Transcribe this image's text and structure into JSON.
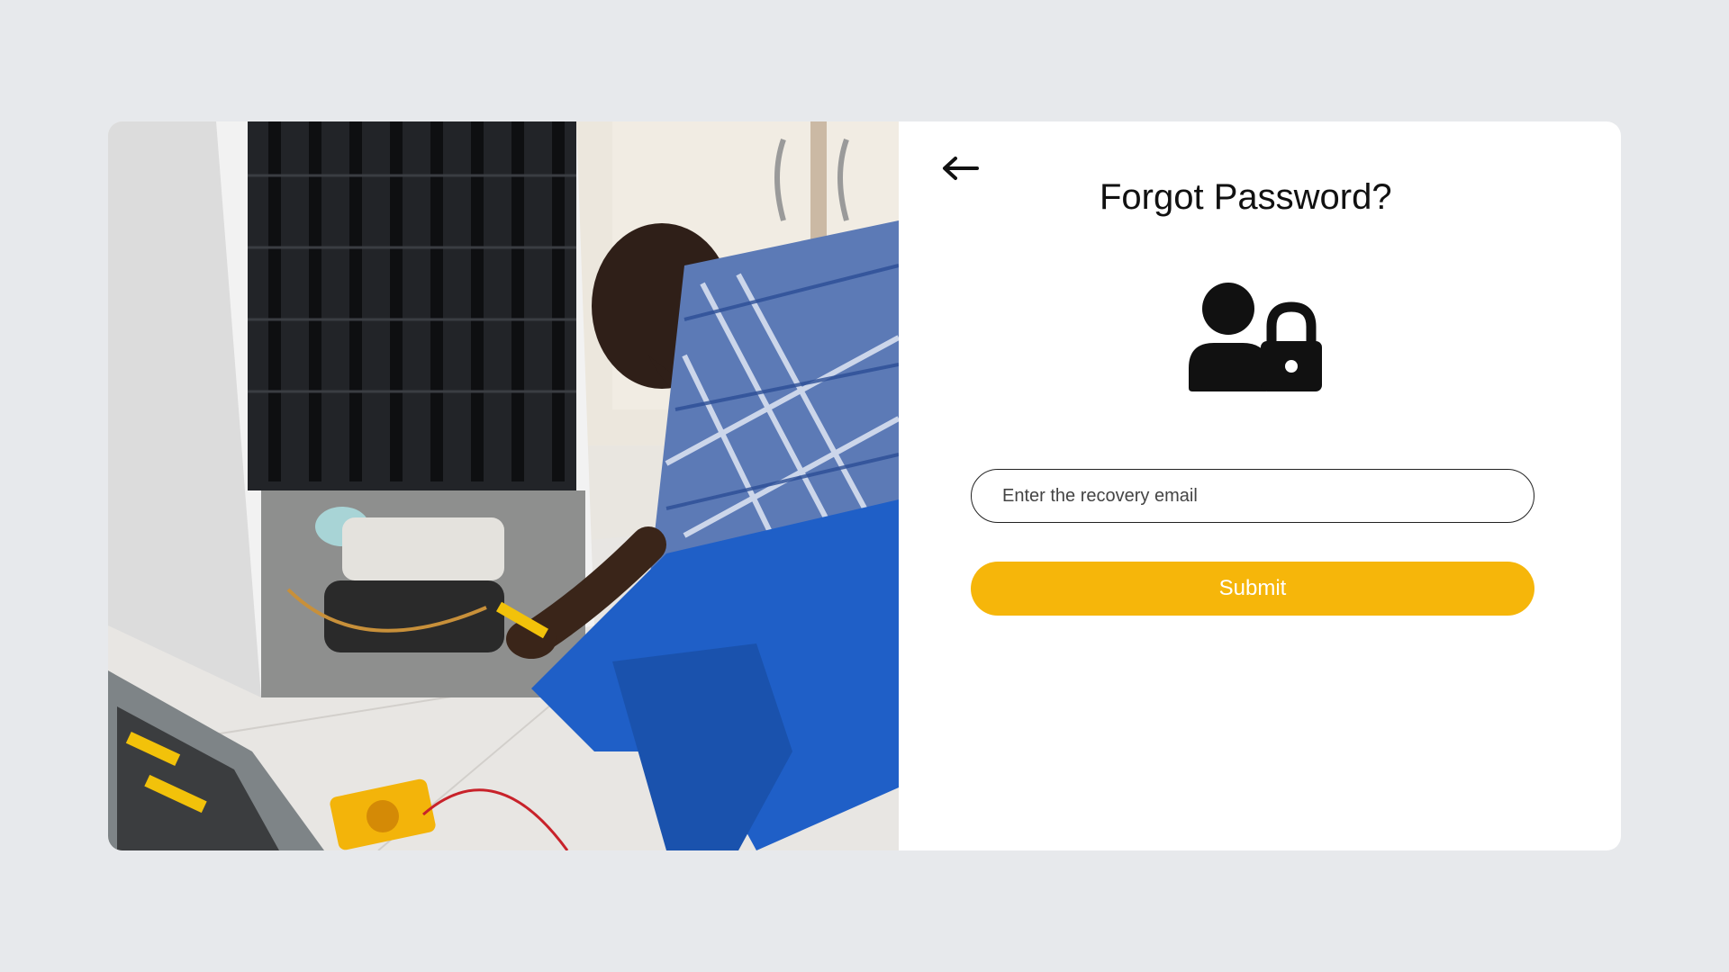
{
  "page": {
    "title": "Forgot Password?",
    "back_icon": "arrow-left-icon",
    "illustration_icon": "user-lock-icon"
  },
  "form": {
    "email_placeholder": "Enter the recovery email",
    "submit_label": "Submit"
  },
  "colors": {
    "background": "#e7e9ec",
    "card": "#ffffff",
    "accent": "#f6b60a",
    "text": "#111111"
  }
}
